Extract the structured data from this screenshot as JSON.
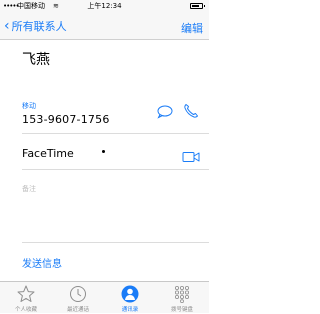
{
  "status_bar": {
    "carrier": "中国移动",
    "time": "上午12:34",
    "signal": "•••••",
    "wifi": "≋"
  },
  "nav": {
    "back_label": "所有联系人",
    "back_icon": "chevron-left-icon",
    "edit_label": "编辑"
  },
  "contact": {
    "name": "飞燕",
    "phone_label": "移动",
    "phone_number": "153-9607-1756",
    "facetime_label": "FaceTime",
    "notes_label": "备注",
    "send_message_label": "发送信息"
  },
  "tabs": [
    {
      "label": "个人收藏",
      "icon": "star-icon",
      "active": false
    },
    {
      "label": "最近通话",
      "icon": "clock-icon",
      "active": false
    },
    {
      "label": "通讯录",
      "icon": "person-icon",
      "active": true
    },
    {
      "label": "拨号键盘",
      "icon": "keypad-icon",
      "active": false
    }
  ],
  "colors": {
    "accent": "#1a7cf7",
    "inactive_tab": "#8e8e8e",
    "divider": "#dcdcdc"
  }
}
